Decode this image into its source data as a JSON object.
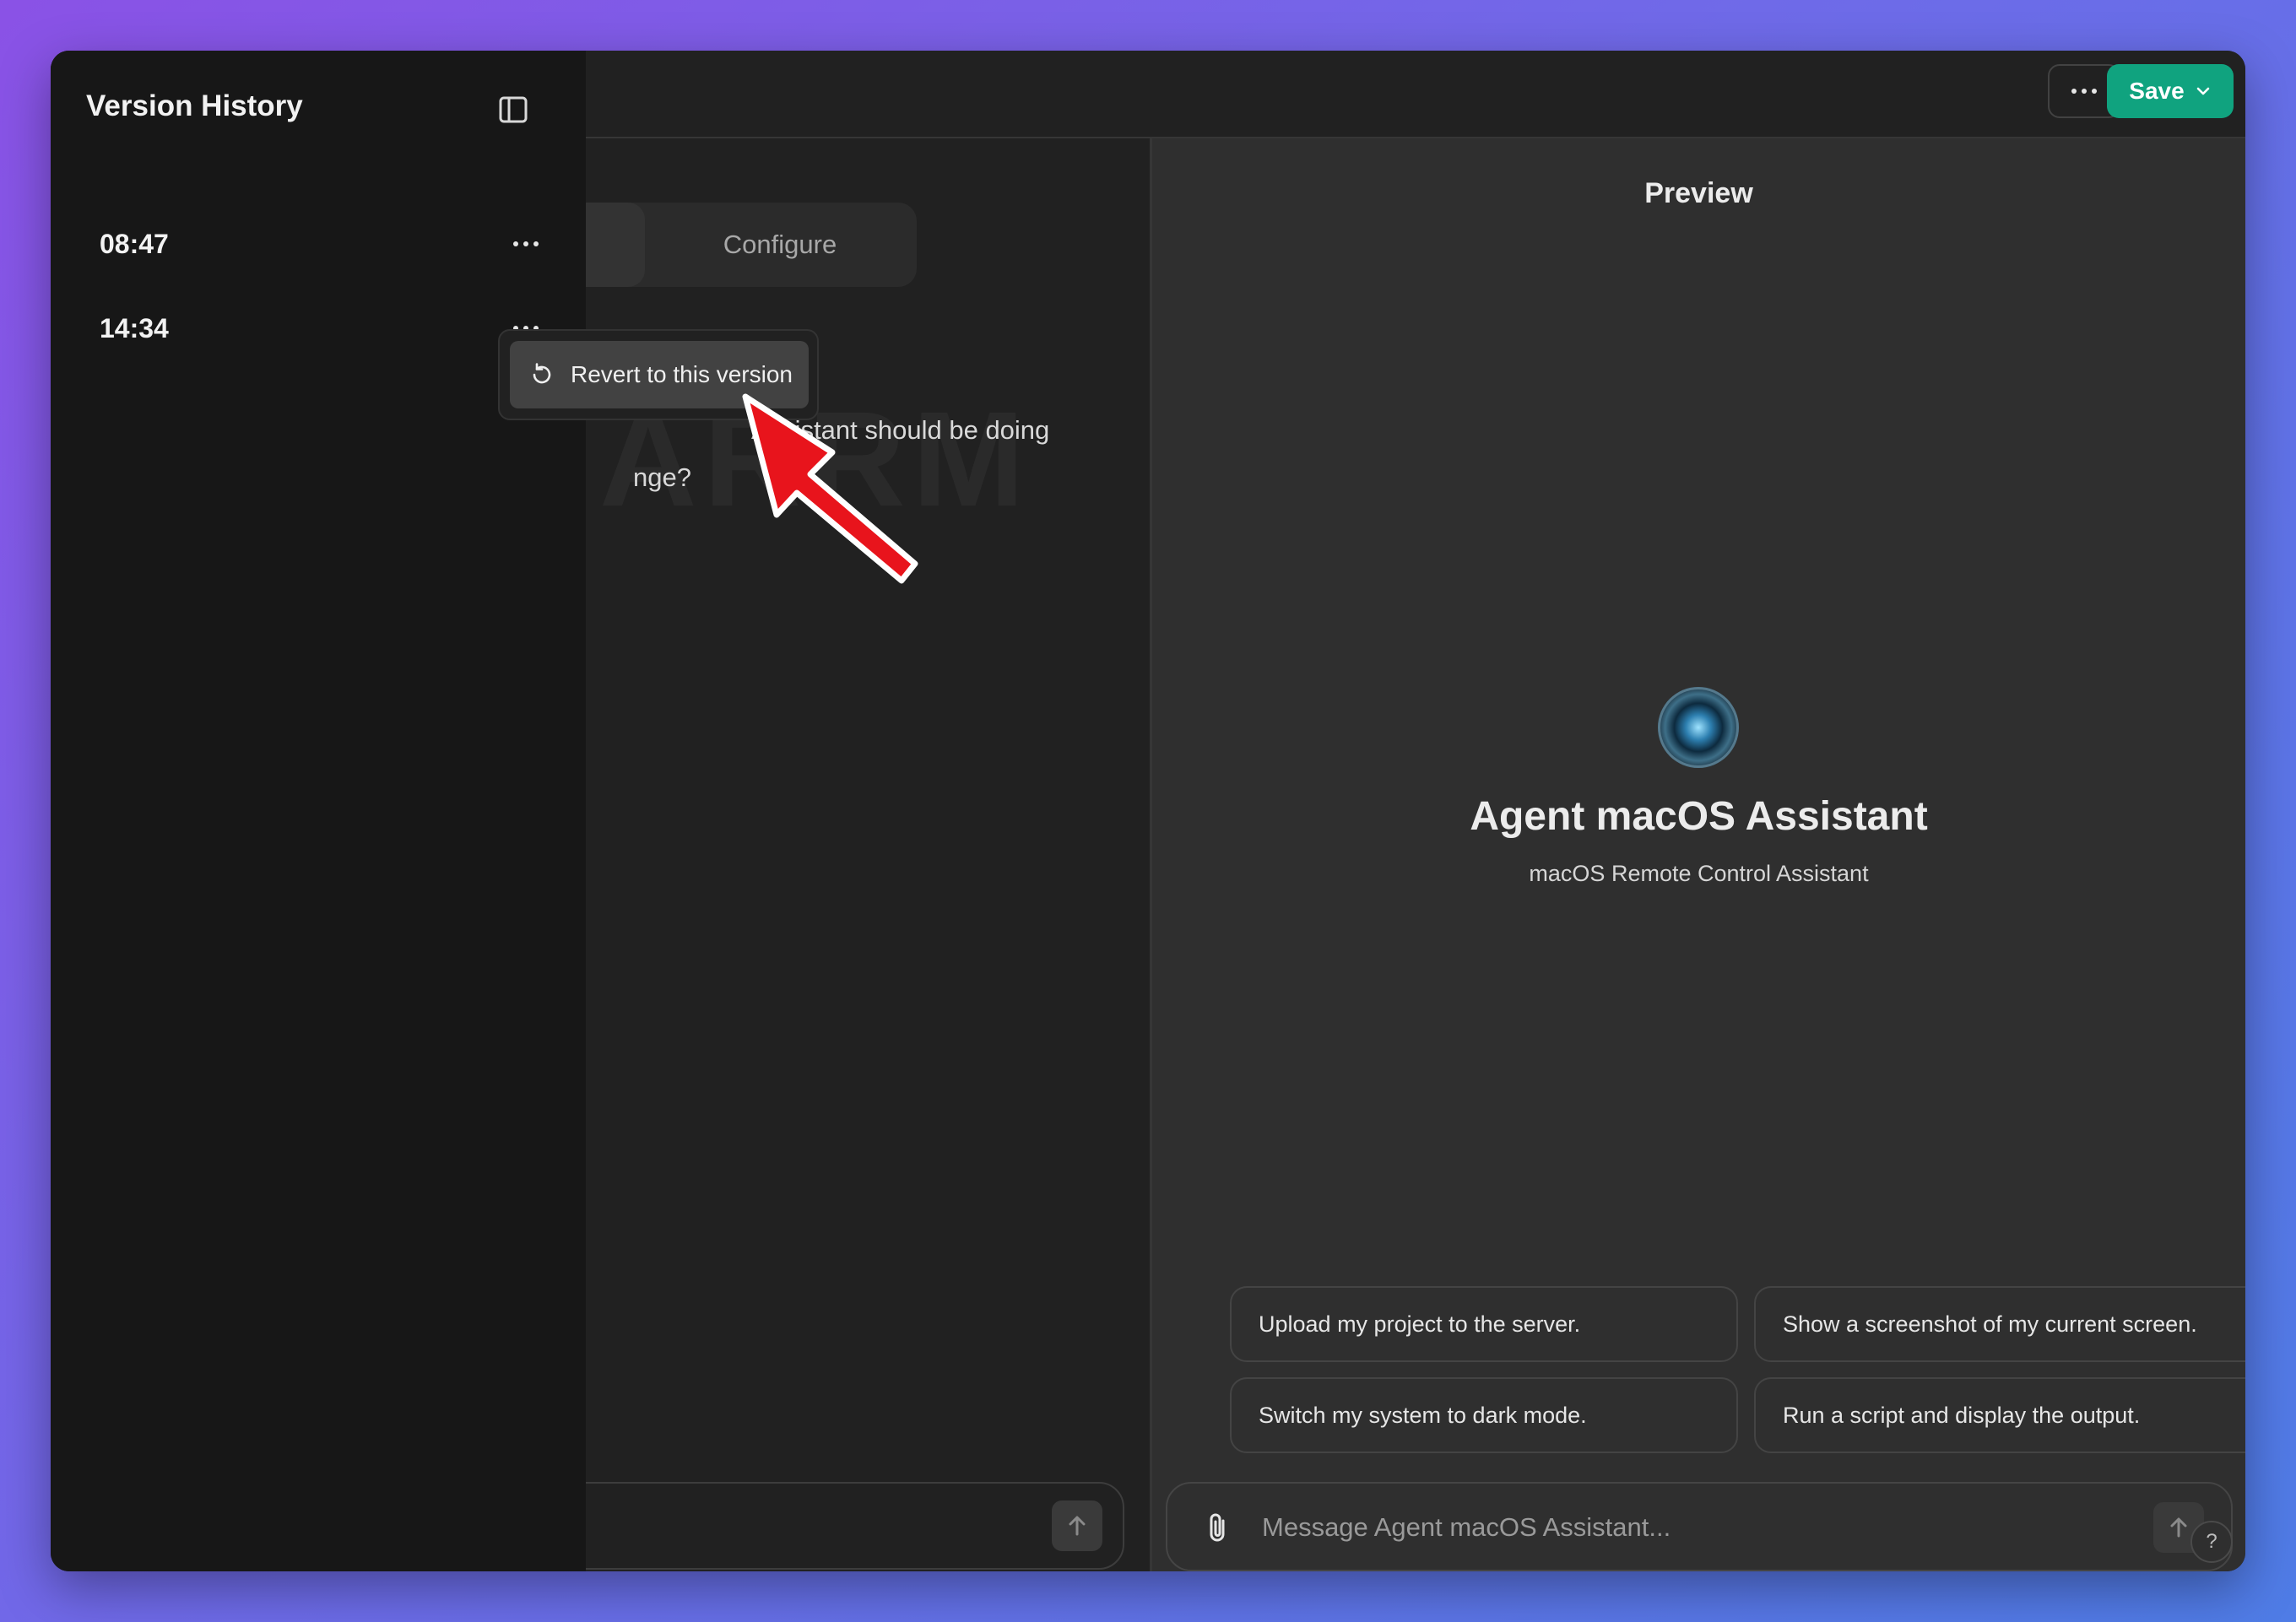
{
  "sidebar": {
    "title": "Version History",
    "versions": [
      {
        "time": "08:47"
      },
      {
        "time": "14:34"
      }
    ],
    "context_menu": {
      "revert_label": "Revert to this version"
    }
  },
  "toolbar": {
    "save_label": "Save"
  },
  "builder": {
    "configure_tab": "Configure",
    "background_text": "ARRM",
    "prompt_line1": "Assistant should be doing",
    "prompt_line2": "nge?"
  },
  "preview": {
    "title": "Preview",
    "agent_name": "Agent macOS Assistant",
    "agent_description": "macOS Remote Control Assistant",
    "suggestions": [
      "Upload my project to the server.",
      "Show a screenshot of my current screen.",
      "Switch my system to dark mode.",
      "Run a script and display the output."
    ],
    "message_placeholder": "Message Agent macOS Assistant...",
    "help_label": "?"
  },
  "colors": {
    "save_green": "#10a37f",
    "annotation_arrow": "#e8141c",
    "sidebar_bg": "#171717",
    "window_bg": "#212121"
  },
  "icons": [
    "sidebar-toggle-icon",
    "more-horizontal-icon",
    "chevron-down-icon",
    "revert-icon",
    "paperclip-icon",
    "arrow-up-icon",
    "sliders-icon",
    "help-icon"
  ]
}
